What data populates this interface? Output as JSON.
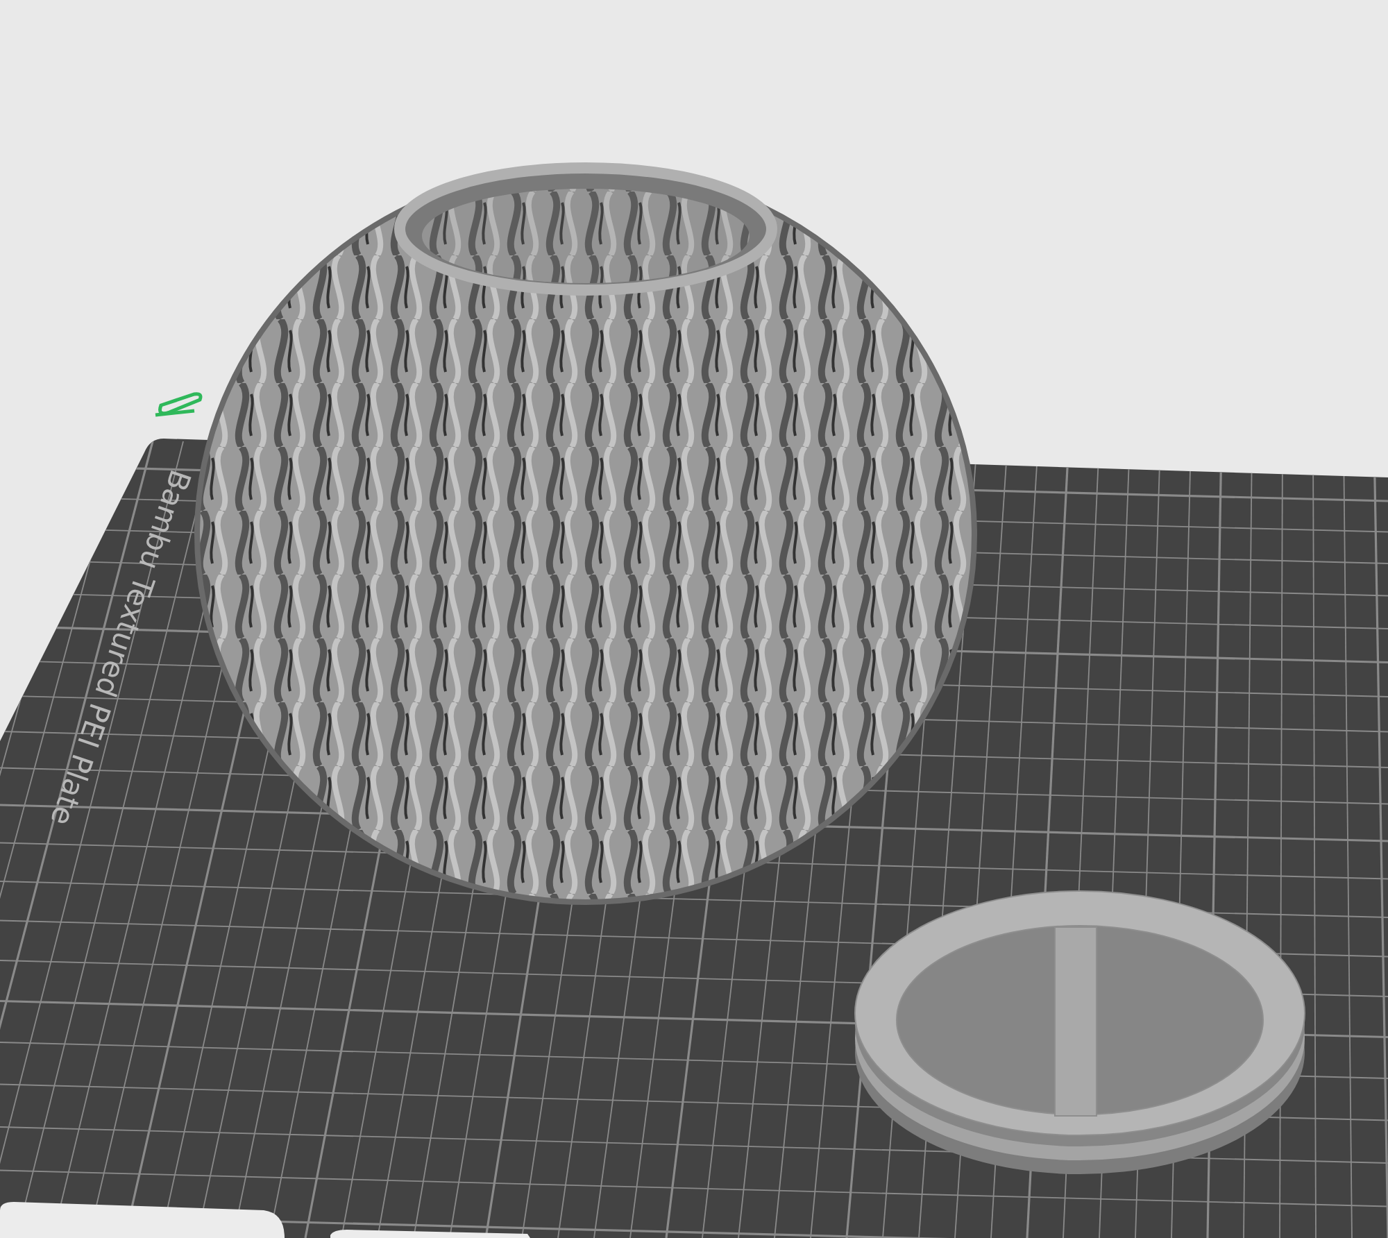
{
  "viewport": {
    "plate_label": "Bambu Textured PEI Plate"
  }
}
